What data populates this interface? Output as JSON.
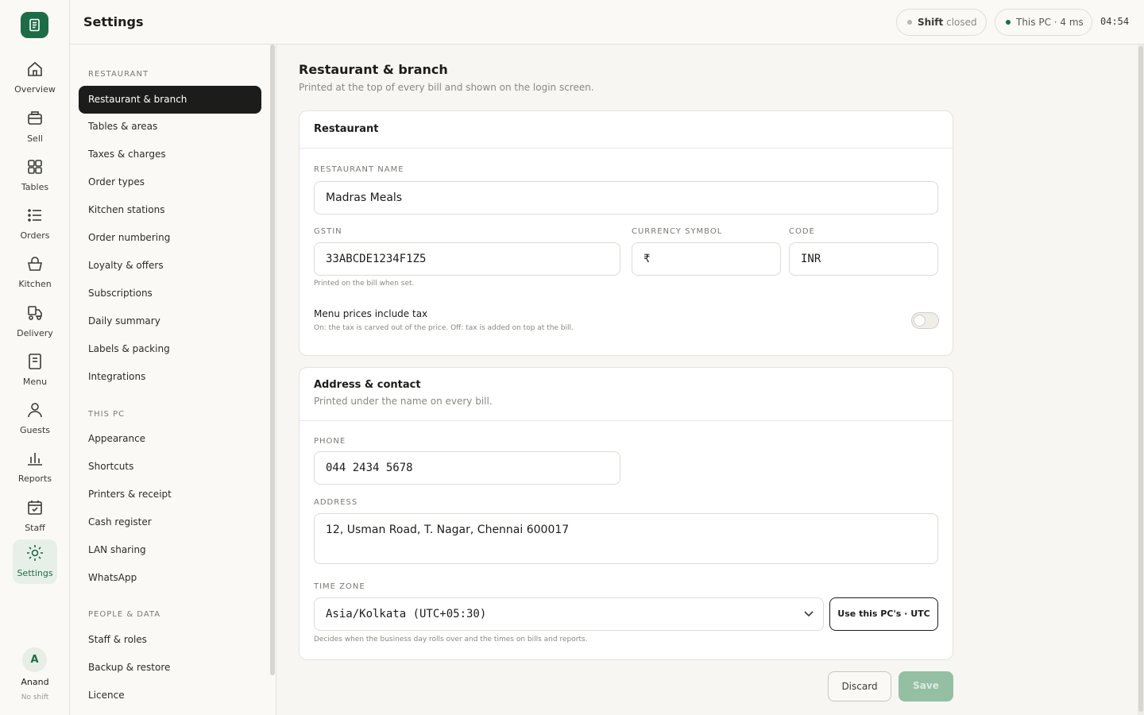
{
  "app": {
    "page_title": "Settings"
  },
  "status": {
    "shift_label": "Shift",
    "shift_state": "closed",
    "pc_status": "This PC · 4 ms",
    "clock": "04:54"
  },
  "colors": {
    "brand": "#1e6b47",
    "shift_dot": "#b8b6ae",
    "pc_dot": "#1e6b47"
  },
  "rail": {
    "items": [
      {
        "label": "Overview",
        "icon": "home-icon"
      },
      {
        "label": "Sell",
        "icon": "register-icon"
      },
      {
        "label": "Tables",
        "icon": "grid-icon"
      },
      {
        "label": "Orders",
        "icon": "list-icon"
      },
      {
        "label": "Kitchen",
        "icon": "basket-icon"
      },
      {
        "label": "Delivery",
        "icon": "scooter-icon"
      },
      {
        "label": "Menu",
        "icon": "menu-doc-icon"
      },
      {
        "label": "Guests",
        "icon": "person-icon"
      },
      {
        "label": "Reports",
        "icon": "bar-chart-icon"
      },
      {
        "label": "Staff",
        "icon": "calendar-icon"
      },
      {
        "label": "Settings",
        "icon": "gear-icon"
      }
    ],
    "user": {
      "initial": "A",
      "name": "Anand",
      "shift": "No shift"
    }
  },
  "subnav": {
    "sections": [
      {
        "title": "RESTAURANT",
        "items": [
          "Restaurant & branch",
          "Tables & areas",
          "Taxes & charges",
          "Order types",
          "Kitchen stations",
          "Order numbering",
          "Loyalty & offers",
          "Subscriptions",
          "Daily summary",
          "Labels & packing",
          "Integrations"
        ]
      },
      {
        "title": "THIS PC",
        "items": [
          "Appearance",
          "Shortcuts",
          "Printers & receipt",
          "Cash register",
          "LAN sharing",
          "WhatsApp"
        ]
      },
      {
        "title": "PEOPLE & DATA",
        "items": [
          "Staff & roles",
          "Backup & restore",
          "Licence"
        ]
      }
    ]
  },
  "main": {
    "title": "Restaurant & branch",
    "subtitle": "Printed at the top of every bill and shown on the login screen.",
    "restaurant_card": {
      "title": "Restaurant",
      "name_label": "RESTAURANT NAME",
      "name_value": "Madras Meals",
      "gstin_label": "GSTIN",
      "gstin_value": "33ABCDE1234F1Z5",
      "gstin_help": "Printed on the bill when set.",
      "currency_label": "CURRENCY SYMBOL",
      "currency_value": "₹",
      "code_label": "CODE",
      "code_value": "INR",
      "tax_toggle_label": "Menu prices include tax",
      "tax_toggle_help": "On: the tax is carved out of the price. Off: tax is added on top at the bill.",
      "tax_toggle_on": false
    },
    "address_card": {
      "title": "Address & contact",
      "subtitle": "Printed under the name on every bill.",
      "phone_label": "PHONE",
      "phone_value": "044 2434 5678",
      "address_label": "ADDRESS",
      "address_value": "12, Usman Road, T. Nagar, Chennai 600017",
      "tz_label": "TIME ZONE",
      "tz_value": "Asia/Kolkata (UTC+05:30)",
      "tz_button": "Use this PC's · UTC",
      "tz_help": "Decides when the business day rolls over and the times on bills and reports."
    },
    "discard_label": "Discard",
    "save_label": "Save"
  }
}
